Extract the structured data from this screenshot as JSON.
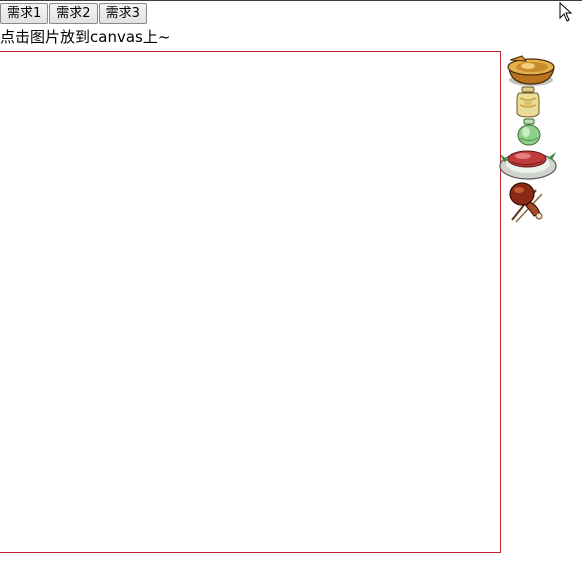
{
  "toolbar": {
    "buttons": [
      {
        "label": "需求1"
      },
      {
        "label": "需求2"
      },
      {
        "label": "需求3"
      }
    ]
  },
  "hint_text": "点击图片放到canvas上~",
  "canvas": {
    "border_color": "#c1272d"
  },
  "food_images": [
    {
      "icon": "bread-bowl-icon"
    },
    {
      "icon": "yellow-jar-icon"
    },
    {
      "icon": "green-jar-icon"
    },
    {
      "icon": "meat-plate-icon"
    },
    {
      "icon": "roast-drumstick-icon"
    }
  ],
  "cursor": {
    "icon": "mouse-pointer-icon"
  }
}
